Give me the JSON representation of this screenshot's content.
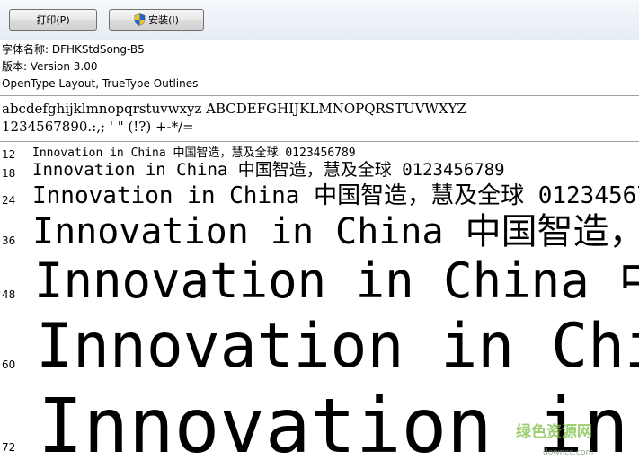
{
  "toolbar": {
    "print_label": "打印(P)",
    "install_label": "安装(I)"
  },
  "font_info": {
    "name_line": "字体名称: DFHKStdSong-B5",
    "version_line": "版本: Version 3.00",
    "type_line": "OpenType Layout, TrueType Outlines"
  },
  "charset": {
    "line1": "abcdefghijklmnopqrstuvwxyz ABCDEFGHIJKLMNOPQRSTUVWXYZ",
    "line2": "1234567890.:,;  ' \" (!?) +-*/="
  },
  "sample_text": "Innovation in China 中国智造，慧及全球 0123456789",
  "samples": [
    {
      "size": "12"
    },
    {
      "size": "18"
    },
    {
      "size": "24"
    },
    {
      "size": "36"
    },
    {
      "size": "48"
    },
    {
      "size": "60"
    },
    {
      "size": "72"
    }
  ],
  "watermark": {
    "text": "绿色资源网",
    "url": "downcc.com"
  }
}
